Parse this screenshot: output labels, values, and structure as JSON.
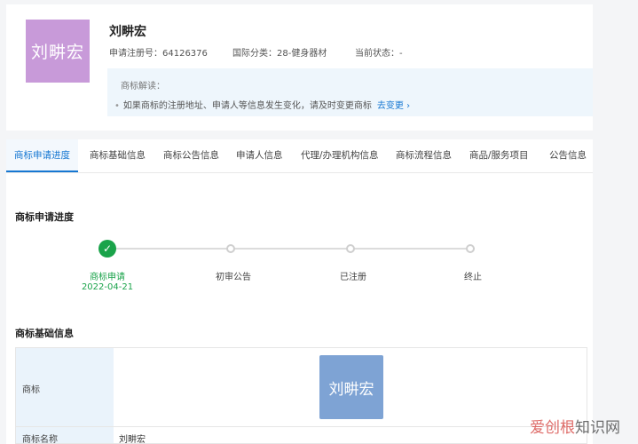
{
  "header": {
    "logo_text": "刘畊宏",
    "name": "刘畊宏",
    "reg_no": "申请注册号：64126376",
    "intl_class": "国际分类：28-健身器材",
    "status": "当前状态：-",
    "notice_title": "商标解读：",
    "notice_text": "如果商标的注册地址、申请人等信息发生变化，请及时变更商标",
    "notice_link": "去变更 ›"
  },
  "tabs": [
    {
      "label": "商标申请进度",
      "active": true
    },
    {
      "label": "商标基础信息"
    },
    {
      "label": "商标公告信息"
    },
    {
      "label": "申请人信息"
    },
    {
      "label": "代理/办理机构信息"
    },
    {
      "label": "商标流程信息"
    },
    {
      "label": "商品/服务项目"
    },
    {
      "label": "公告信息"
    }
  ],
  "progress": {
    "title": "商标申请进度",
    "steps": [
      {
        "label": "商标申请",
        "date": "2022-04-21",
        "done": true
      },
      {
        "label": "初审公告",
        "done": false
      },
      {
        "label": "已注册",
        "done": false
      },
      {
        "label": "终止",
        "done": false
      }
    ],
    "check_glyph": "✓"
  },
  "basic_info": {
    "title": "商标基础信息",
    "row1_label": "商标",
    "image_text": "刘畊宏",
    "row2_label": "商标名称",
    "row2_value": "刘畊宏"
  },
  "watermark": {
    "part1": "爱创根",
    "part2": "知识网"
  },
  "colors": {
    "accent": "#1677d2",
    "success": "#1aa34a",
    "logo_bg": "#c89ad9",
    "image_bg": "#7ea3d4"
  }
}
